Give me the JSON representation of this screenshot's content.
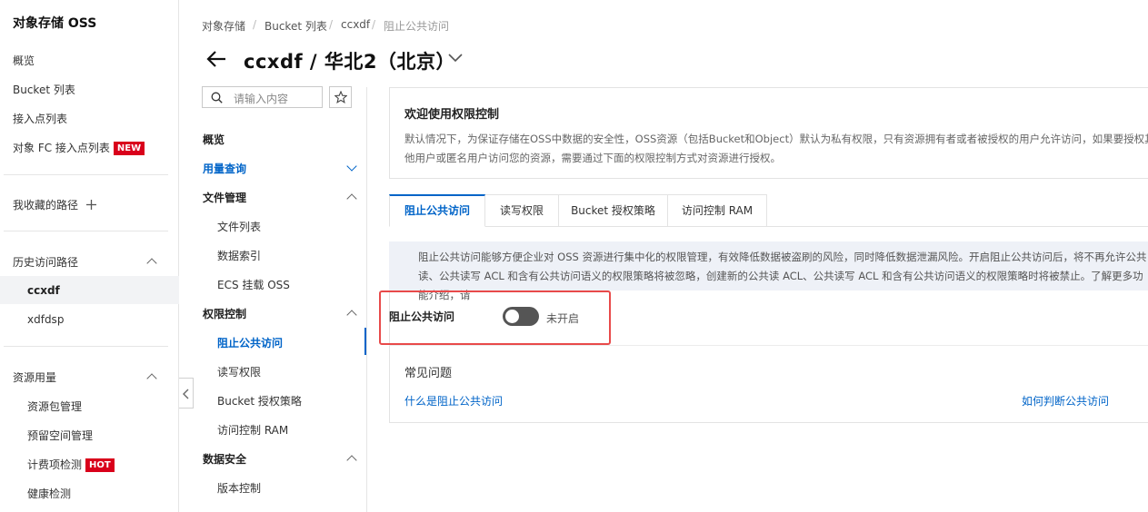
{
  "sidebar": {
    "title": "对象存储 OSS",
    "items": [
      {
        "label": "概览"
      },
      {
        "label": "Bucket 列表"
      },
      {
        "label": "接入点列表"
      },
      {
        "label": "对象 FC 接入点列表",
        "tag": "NEW"
      }
    ],
    "favorites_label": "我收藏的路径",
    "favorites_add_icon": "plus-icon",
    "history": {
      "label": "历史访问路径",
      "items": [
        {
          "label": "ccxdf"
        },
        {
          "label": "xdfdsp"
        }
      ]
    },
    "resources": {
      "label": "资源用量",
      "items": [
        {
          "label": "资源包管理"
        },
        {
          "label": "预留空间管理"
        },
        {
          "label": "计费项检测",
          "tag": "HOT"
        },
        {
          "label": "健康检测"
        }
      ]
    }
  },
  "breadcrumb": {
    "items": [
      "对象存储",
      "Bucket 列表",
      "ccxdf",
      "阻止公共访问"
    ],
    "separator": "/"
  },
  "header": {
    "title": "ccxdf / 华北2（北京）",
    "back_icon": "arrow-left-icon",
    "dropdown_icon": "chevron-down-icon"
  },
  "subnav": {
    "search_placeholder": "请输入内容",
    "search_icon": "search-icon",
    "star_icon": "star-icon",
    "groups": [
      {
        "label": "概览"
      },
      {
        "label": "用量查询"
      },
      {
        "label": "文件管理",
        "children": [
          {
            "label": "文件列表"
          },
          {
            "label": "数据索引"
          },
          {
            "label": "ECS 挂载 OSS"
          }
        ]
      },
      {
        "label": "权限控制",
        "children": [
          {
            "label": "阻止公共访问"
          },
          {
            "label": "读写权限"
          },
          {
            "label": "Bucket 授权策略"
          },
          {
            "label": "访问控制 RAM"
          }
        ]
      },
      {
        "label": "数据安全",
        "children": [
          {
            "label": "版本控制"
          }
        ]
      }
    ]
  },
  "welcome": {
    "title": "欢迎使用权限控制",
    "description": "默认情况下，为保证存储在OSS中数据的安全性，OSS资源（包括Bucket和Object）默认为私有权限，只有资源拥有者或者被授权的用户允许访问，如果要授权其他用户或匿名用户访问您的资源，需要通过下面的权限控制方式对资源进行授权。"
  },
  "tabs": [
    {
      "label": "阻止公共访问"
    },
    {
      "label": "读写权限"
    },
    {
      "label": "Bucket 授权策略"
    },
    {
      "label": "访问控制 RAM"
    }
  ],
  "info": {
    "text": "阻止公共访问能够方便企业对 OSS 资源进行集中化的权限管理，有效降低数据被盗刷的风险，同时降低数据泄漏风险。开启阻止公共访问后，将不再允许公共读、公共读写 ACL 和含有公共访问语义的权限策略将被忽略，创建新的公共读 ACL、公共读写 ACL 和含有公共访问语义的权限策略时将被禁止。了解更多功能介绍，请"
  },
  "block_public_access": {
    "label": "阻止公共访问",
    "enabled": false,
    "status_text": "未开启"
  },
  "faq": {
    "title": "常见问题",
    "links": [
      "什么是阻止公共访问",
      "如何判断公共访问"
    ]
  },
  "colors": {
    "accent": "#0064c8",
    "highlight": "#e84a4a",
    "tag_bg": "#d9001b",
    "toggle_off": "#555555"
  }
}
